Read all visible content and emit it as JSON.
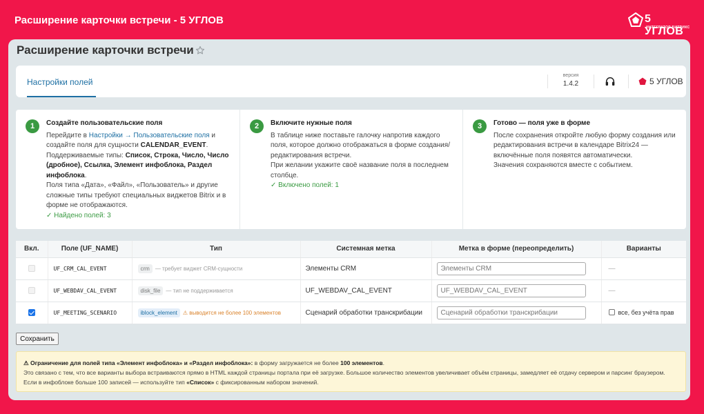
{
  "app": {
    "title": "Расширение карточки встречи - 5 УГЛОВ",
    "brand_name": "5 УГЛОВ",
    "brand_sub": "ИНТЕГРАТОР БИТРИКС"
  },
  "page": {
    "title": "Расширение карточки встречи",
    "tab_active": "Настройки полей",
    "version_label": "версия",
    "version": "1.4.2",
    "brand_link": "5 УГЛОВ"
  },
  "steps": [
    {
      "num": "1",
      "title": "Создайте пользовательские поля",
      "intro": "Перейдите в ",
      "link1": "Настройки",
      "arrow": " → ",
      "link2": "Пользовательские поля",
      "after_link": " и создайте поля для сущности ",
      "entity": "CALENDAR_EVENT",
      "types_intro": ". Поддерживаемые типы: ",
      "types": "Список, Строка, Число, Число (дробное), Ссылка, Элемент инфоблока, Раздел инфоблока",
      "types_end": ".",
      "note": "Поля типа «Дата», «Файл», «Пользователь» и другие сложные типы требуют специальных виджетов Bitrix и в форме не отображаются.",
      "status": "✓ Найдено полей: 3"
    },
    {
      "num": "2",
      "title": "Включите нужные поля",
      "p1": "В таблице ниже поставьте галочку напротив каждого поля, которое должно отображаться в форме создания/редактирования встречи.",
      "p2": "При желании укажите своё название поля в последнем столбце.",
      "status": "✓ Включено полей: 1"
    },
    {
      "num": "3",
      "title": "Готово — поля уже в форме",
      "p1": "После сохранения откройте любую форму создания или редактирования встречи в календаре Bitrix24 — включённые поля появятся автоматически.",
      "p2": "Значения сохраняются вместе с событием."
    }
  ],
  "table": {
    "headers": [
      "Вкл.",
      "Поле (UF_NAME)",
      "Тип",
      "Системная метка",
      "Метка в форме (переопределить)",
      "Варианты"
    ],
    "rows": [
      {
        "checked": false,
        "field": "UF_CRM_CAL_EVENT",
        "type_tag": "crm",
        "type_note": "— требует виджет CRM-сущности",
        "system_label": "Элементы CRM",
        "form_label_placeholder": "Элементы CRM",
        "variants": "—"
      },
      {
        "checked": false,
        "field": "UF_WEBDAV_CAL_EVENT",
        "type_tag": "disk_file",
        "type_note": "— тип не поддерживается",
        "system_label": "UF_WEBDAV_CAL_EVENT",
        "form_label_placeholder": "UF_WEBDAV_CAL_EVENT",
        "variants": "—"
      },
      {
        "checked": true,
        "field": "UF_MEETING_SCENARIO",
        "type_tag": "iblock_element",
        "type_note": "⚠ выводится не более 100 элементов",
        "system_label": "Сценарий обработки транскрибации",
        "form_label_placeholder": "Сценарий обработки транскрибации",
        "variants": "все, без учёта прав"
      }
    ]
  },
  "save_label": "Сохранить",
  "alert": {
    "head": "⚠ Ограничение для полей типа «Элемент инфоблока» и «Раздел инфоблока»:",
    "head_rest": " в форму загружается не более ",
    "limit": "100 элементов",
    "dot": ".",
    "body": "Это связано с тем, что все варианты выбора встраиваются прямо в HTML каждой страницы портала при её загрузке. Большое количество элементов увеличивает объём страницы, замедляет её отдачу сервером и парсинг браузером. Если в инфоблоке больше 100 записей — используйте тип ",
    "type": "«Список»",
    "tail": " с фиксированным набором значений."
  },
  "colors": {
    "brand_red": "#f1164a",
    "link_blue": "#1d6fa3",
    "ok_green": "#3a9a42",
    "warn_orange": "#d9822b",
    "alert_bg": "#fdf6d8"
  }
}
